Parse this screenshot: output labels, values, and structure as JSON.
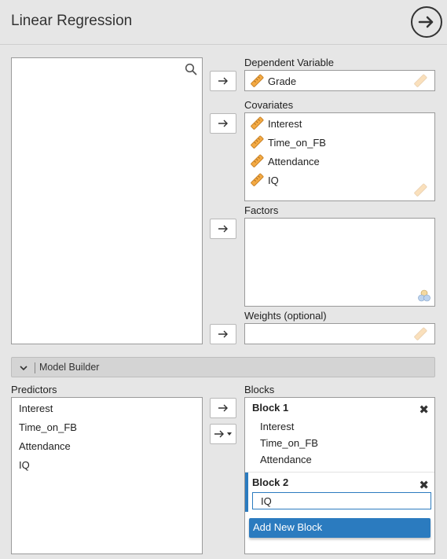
{
  "header": {
    "title": "Linear Regression"
  },
  "dependent": {
    "label": "Dependent Variable",
    "value": "Grade"
  },
  "covariates": {
    "label": "Covariates",
    "items": [
      "Interest",
      "Time_on_FB",
      "Attendance",
      "IQ"
    ]
  },
  "factors": {
    "label": "Factors"
  },
  "weights": {
    "label": "Weights (optional)"
  },
  "model_builder": {
    "label": "Model Builder"
  },
  "predictors": {
    "label": "Predictors",
    "items": [
      "Interest",
      "Time_on_FB",
      "Attendance",
      "IQ"
    ]
  },
  "blocks": {
    "label": "Blocks",
    "block1": {
      "title": "Block 1",
      "items": [
        "Interest",
        "Time_on_FB",
        "Attendance"
      ]
    },
    "block2": {
      "title": "Block 2",
      "input_value": "IQ"
    },
    "add_label": "Add New Block"
  },
  "colors": {
    "accent": "#2b7bbf",
    "scale_icon": "#f0a030"
  },
  "icons": [
    "search-icon",
    "arrow-circle-right-icon",
    "arrow-right-icon",
    "scale-ruler-icon",
    "nominal-icon",
    "chevron-down-icon",
    "close-icon"
  ]
}
